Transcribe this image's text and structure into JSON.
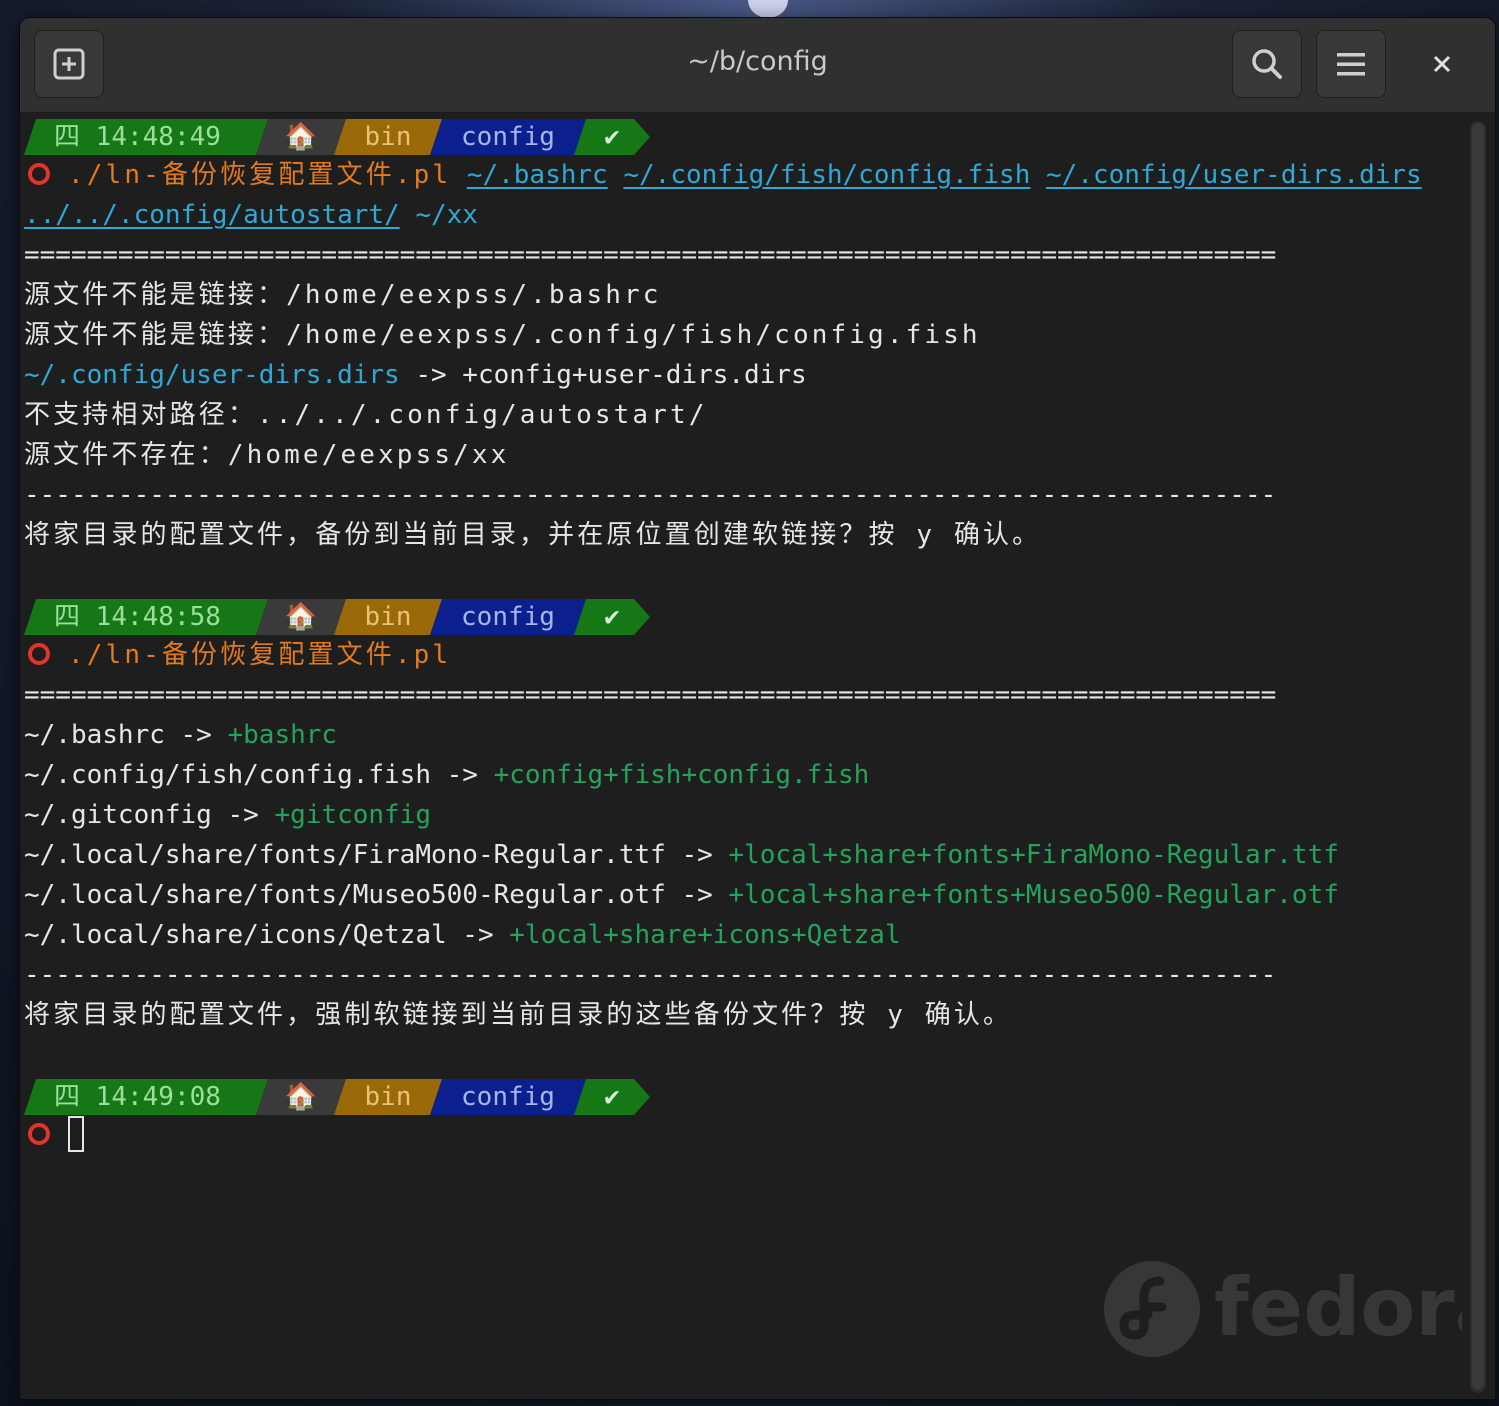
{
  "window": {
    "title": "~/b/config"
  },
  "prompts": [
    {
      "day": "四",
      "time": "14:48:49",
      "home_icon": "🏠",
      "dir1": "bin",
      "dir2": "config",
      "status": "✔"
    },
    {
      "day": "四",
      "time": "14:48:58",
      "home_icon": "🏠",
      "dir1": "bin",
      "dir2": "config",
      "status": "✔"
    },
    {
      "day": "四",
      "time": "14:49:08",
      "home_icon": "🏠",
      "dir1": "bin",
      "dir2": "config",
      "status": "✔"
    }
  ],
  "block1": {
    "command": "./ln-备份恢复配置文件.pl",
    "arg1": "~/.bashrc",
    "arg2": "~/.config/fish/config.fish",
    "arg3": "~/.config/user-dirs.dirs",
    "arg4": "../../.config/autostart/",
    "arg5": "~/xx",
    "sep_eq": "================================================================================",
    "out1": "源文件不能是链接：/home/eexpss/.bashrc",
    "out2": "源文件不能是链接：/home/eexpss/.config/fish/config.fish",
    "out3_src": "~/.config/user-dirs.dirs",
    "out3_rest": " -> +config+user-dirs.dirs",
    "out4": "不支持相对路径：../../.config/autostart/",
    "out5": "源文件不存在：/home/eexpss/xx",
    "sep_dash": "--------------------------------------------------------------------------------",
    "confirm": "将家目录的配置文件，备份到当前目录，并在原位置创建软链接？按 y 确认。"
  },
  "block2": {
    "command": "./ln-备份恢复配置文件.pl",
    "sep_eq": "================================================================================",
    "rows": [
      {
        "src": "~/.bashrc -> ",
        "dst": "+bashrc"
      },
      {
        "src": "~/.config/fish/config.fish -> ",
        "dst": "+config+fish+config.fish"
      },
      {
        "src": "~/.gitconfig -> ",
        "dst": "+gitconfig"
      },
      {
        "src": "~/.local/share/fonts/FiraMono-Regular.ttf -> ",
        "dst": "+local+share+fonts+FiraMono-Regular.ttf"
      },
      {
        "src": "~/.local/share/fonts/Museo500-Regular.otf -> ",
        "dst": "+local+share+fonts+Museo500-Regular.otf"
      },
      {
        "src": "~/.local/share/icons/Qetzal -> ",
        "dst": "+local+share+icons+Qetzal"
      }
    ],
    "sep_dash": "--------------------------------------------------------------------------------",
    "confirm": "将家目录的配置文件，强制软链接到当前目录的这些备份文件？按 y 确认。"
  },
  "watermark": "fedora",
  "colors": {
    "prompt_green": "#157715",
    "prompt_gold": "#9a6a08",
    "prompt_blue": "#0b1f8e",
    "link": "#2fa8d6",
    "ok_green": "#24a35a",
    "cmd_orange": "#e07b22"
  }
}
